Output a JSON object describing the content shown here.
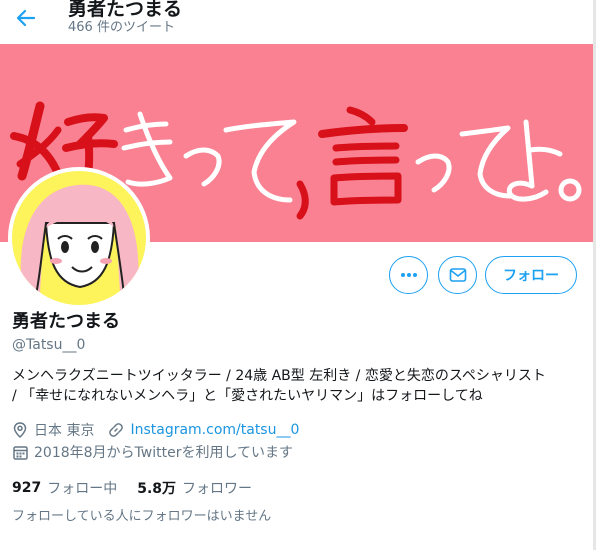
{
  "header": {
    "title": "勇者たつまる",
    "tweet_count": "466 件のツイート"
  },
  "banner": {
    "text": "好きって、言ってよ。",
    "background": "#f98192"
  },
  "actions": {
    "more_label": "…",
    "follow_label": "フォロー"
  },
  "profile": {
    "name": "勇者たつまる",
    "handle": "@Tatsu__0",
    "bio": [
      "メンヘラクズニートツイッタラー / 24歳 AB型 左利き / 恋愛と失恋のスペシャリスト",
      "/ 「幸せになれないメンヘラ」と「愛されたいヤリマン」はフォローしてね"
    ],
    "location": "日本 東京",
    "url": "Instagram.com/tatsu__0",
    "joined": "2018年8月からTwitterを利用しています"
  },
  "stats": {
    "following_count": "927",
    "following_label": "フォロー中",
    "followers_count": "5.8万",
    "followers_label": "フォロワー"
  },
  "notice": "フォローしている人にフォロワーはいません",
  "colors": {
    "accent": "#1da1f2",
    "secondary_text": "#657786"
  }
}
